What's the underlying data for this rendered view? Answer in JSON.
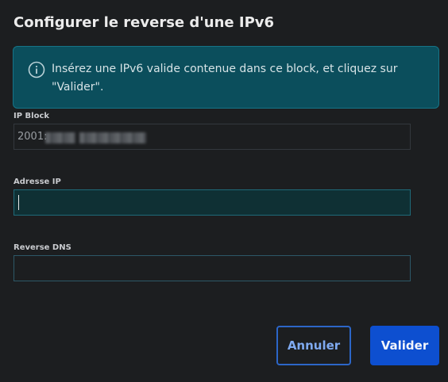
{
  "dialog": {
    "title": "Configurer le reverse d'une IPv6"
  },
  "info": {
    "icon": "info-icon",
    "message": "Insérez une IPv6 valide contenue dans ce block, et cliquez sur \"Valider\"."
  },
  "fields": {
    "ip_block": {
      "label": "IP Block",
      "value": "2001:"
    },
    "address": {
      "label": "Adresse IP",
      "value": ""
    },
    "reverse": {
      "label": "Reverse DNS",
      "value": ""
    }
  },
  "actions": {
    "cancel_label": "Annuler",
    "submit_label": "Valider"
  },
  "colors": {
    "background": "#1c1e20",
    "info_bg": "#0b4e5c",
    "primary": "#0d4fd0",
    "outline": "#2c66c8"
  }
}
